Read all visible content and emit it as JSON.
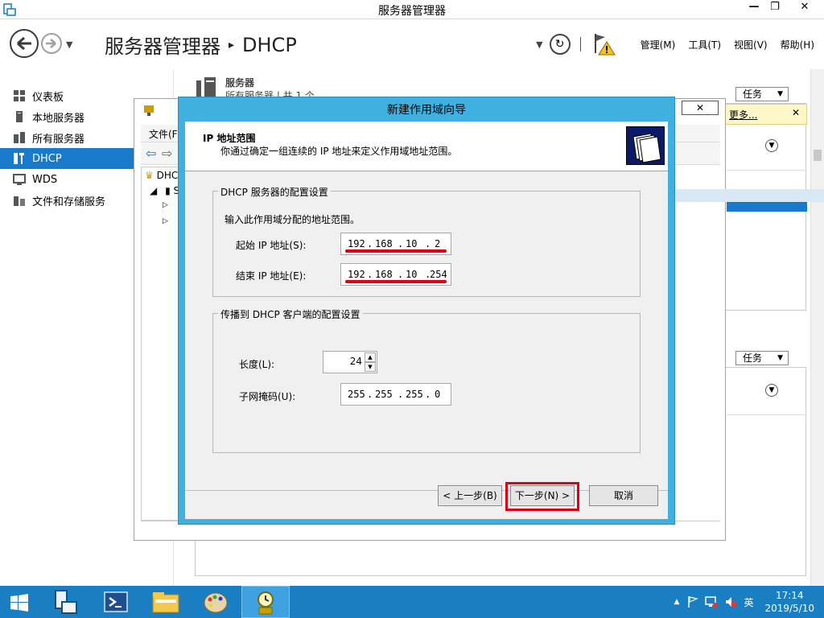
{
  "window": {
    "title": "服务器管理器",
    "min": "—",
    "max": "❐",
    "close": "✕"
  },
  "header": {
    "breadcrumb_root": "服务器管理器",
    "breadcrumb_sep": "▸",
    "breadcrumb_current": "DHCP",
    "menu": [
      "管理(M)",
      "工具(T)",
      "视图(V)",
      "帮助(H)"
    ]
  },
  "sidebar": {
    "items": [
      {
        "label": "仪表板",
        "icon": "dashboard-icon"
      },
      {
        "label": "本地服务器",
        "icon": "server-icon"
      },
      {
        "label": "所有服务器",
        "icon": "servers-icon"
      },
      {
        "label": "DHCP",
        "icon": "dhcp-icon",
        "active": true
      },
      {
        "label": "WDS",
        "icon": "wds-icon"
      },
      {
        "label": "文件和存储服务",
        "icon": "storage-icon"
      }
    ]
  },
  "content": {
    "section_title": "服务器",
    "section_sub": "所有服务器 | 共 1 个",
    "tasks_label": "任务",
    "more_label": "更多...",
    "more_close": "✕"
  },
  "mmc": {
    "menu_first": "文件(F)",
    "tree_root": "DHC",
    "tree_child": "S",
    "close": "✕"
  },
  "wizard": {
    "title": "新建作用域向导",
    "heading": "IP 地址范围",
    "subheading": "你通过确定一组连续的 IP 地址来定义作用域地址范围。",
    "group1_legend": "DHCP 服务器的配置设置",
    "group1_hint": "输入此作用域分配的地址范围。",
    "start_label": "起始 IP 地址(S):",
    "start_ip": [
      "192",
      "168",
      "10",
      "2"
    ],
    "end_label": "结束 IP 地址(E):",
    "end_ip": [
      "192",
      "168",
      "10",
      "254"
    ],
    "group2_legend": "传播到 DHCP 客户端的配置设置",
    "length_label": "长度(L):",
    "length_value": "24",
    "mask_label": "子网掩码(U):",
    "mask_ip": [
      "255",
      "255",
      "255",
      "0"
    ],
    "back_btn": "< 上一步(B)",
    "next_btn": "下一步(N) >",
    "cancel_btn": "取消",
    "highlight_color": "#e00015"
  },
  "taskbar": {
    "ime": "英",
    "time": "17:14",
    "date": "2019/5/10",
    "tray_arrow": "▲"
  },
  "colors": {
    "accent": "#1979ca",
    "wizard_frame": "#40b0e0",
    "taskbar": "#1a7fc2"
  }
}
